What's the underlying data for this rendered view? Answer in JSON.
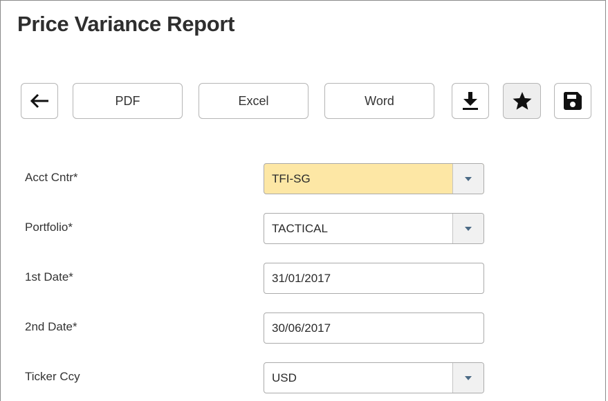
{
  "page": {
    "title": "Price Variance Report"
  },
  "toolbar": {
    "back_icon": "arrow-left-icon",
    "pdf_label": "PDF",
    "excel_label": "Excel",
    "word_label": "Word",
    "download_icon": "download-icon",
    "favorite_icon": "star-icon",
    "save_icon": "floppy-disk-icon"
  },
  "form": {
    "acct_cntr": {
      "label": "Acct Cntr*",
      "value": "TFI-SG",
      "type": "select",
      "highlight_color": "#fde7a5"
    },
    "portfolio": {
      "label": "Portfolio*",
      "value": "TACTICAL",
      "type": "select"
    },
    "first_date": {
      "label": "1st Date*",
      "value": "31/01/2017",
      "type": "text"
    },
    "second_date": {
      "label": "2nd Date*",
      "value": "30/06/2017",
      "type": "text"
    },
    "ticker_ccy": {
      "label": "Ticker Ccy",
      "value": "USD",
      "type": "select"
    }
  },
  "colors": {
    "dropdown_arrow": "#4b6a85",
    "border": "#aaaaaa"
  }
}
